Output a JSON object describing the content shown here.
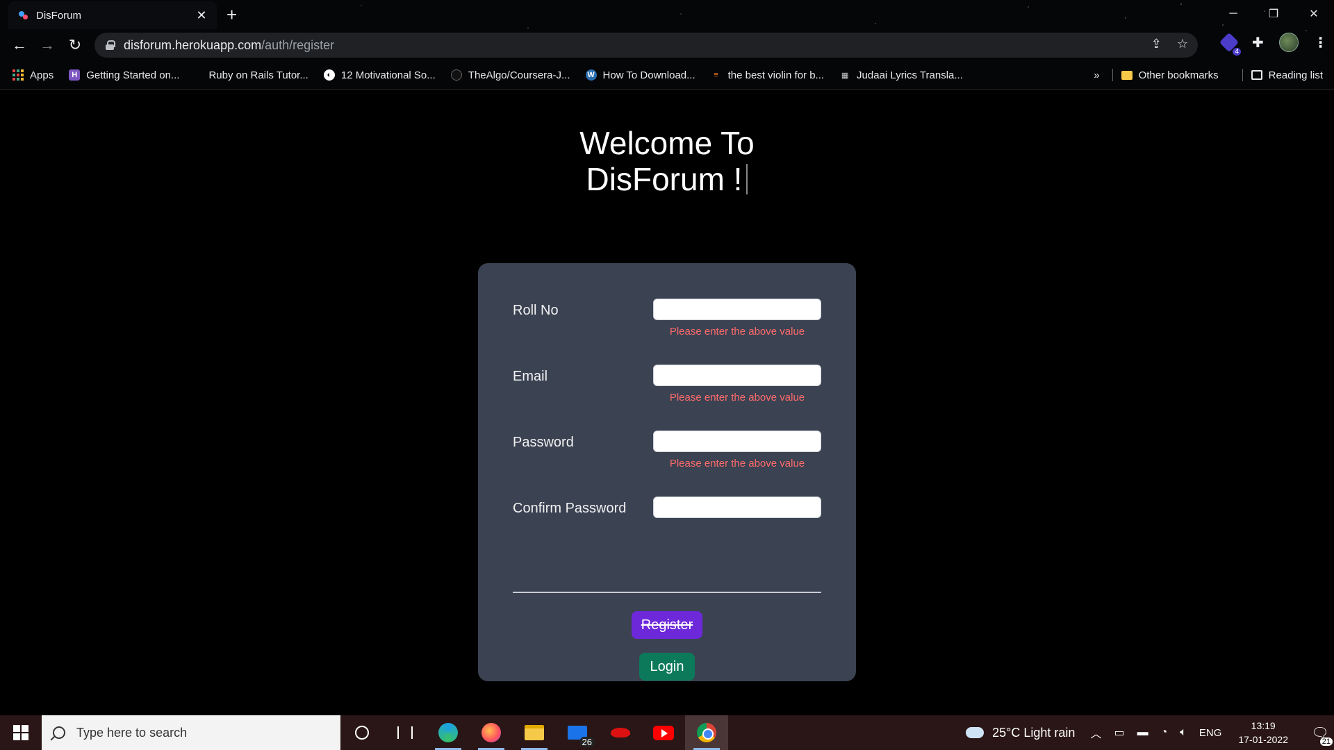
{
  "browser": {
    "tab_title": "DisForum",
    "tab_close": "✕",
    "new_tab": "+",
    "url_host": "disforum.herokuapp.com",
    "url_path": "/auth/register",
    "extension_badge": "4",
    "bookmarks": [
      {
        "label": "Apps",
        "icon": "apps-grid-icon"
      },
      {
        "label": "Getting Started on...",
        "icon": "h-badge-icon"
      },
      {
        "label": "Ruby on Rails Tutor...",
        "icon": "rails-icon"
      },
      {
        "label": "12 Motivational So...",
        "icon": "globe-icon"
      },
      {
        "label": "TheAlgo/Coursera-J...",
        "icon": "github-icon"
      },
      {
        "label": "How To Download...",
        "icon": "wordpress-icon"
      },
      {
        "label": "the best violin for b...",
        "icon": "stackoverflow-icon"
      },
      {
        "label": "Judaai Lyrics Transla...",
        "icon": "clapper-icon"
      }
    ],
    "bookmarks_overflow": "»",
    "other_bookmarks": "Other bookmarks",
    "reading_list": "Reading list"
  },
  "page": {
    "heading_line1": "Welcome To",
    "heading_line2": "DisForum !",
    "fields": [
      {
        "label": "Roll No",
        "value": "",
        "error": "Please enter the above value"
      },
      {
        "label": "Email",
        "value": "",
        "error": "Please enter the above value"
      },
      {
        "label": "Password",
        "value": "",
        "error": "Please enter the above value"
      },
      {
        "label": "Confirm Password",
        "value": "",
        "error": ""
      }
    ],
    "register_label": "Register",
    "login_label": "Login"
  },
  "taskbar": {
    "search_placeholder": "Type here to search",
    "mail_badge": "26",
    "weather": "25°C  Light rain",
    "language": "ENG",
    "time": "13:19",
    "date": "17-01-2022",
    "notifications": "21"
  },
  "colors": {
    "card_bg": "#3b4252",
    "error_text": "#ff6b6b",
    "register_bg": "#6d28d9",
    "login_bg": "#0c7a5a"
  }
}
